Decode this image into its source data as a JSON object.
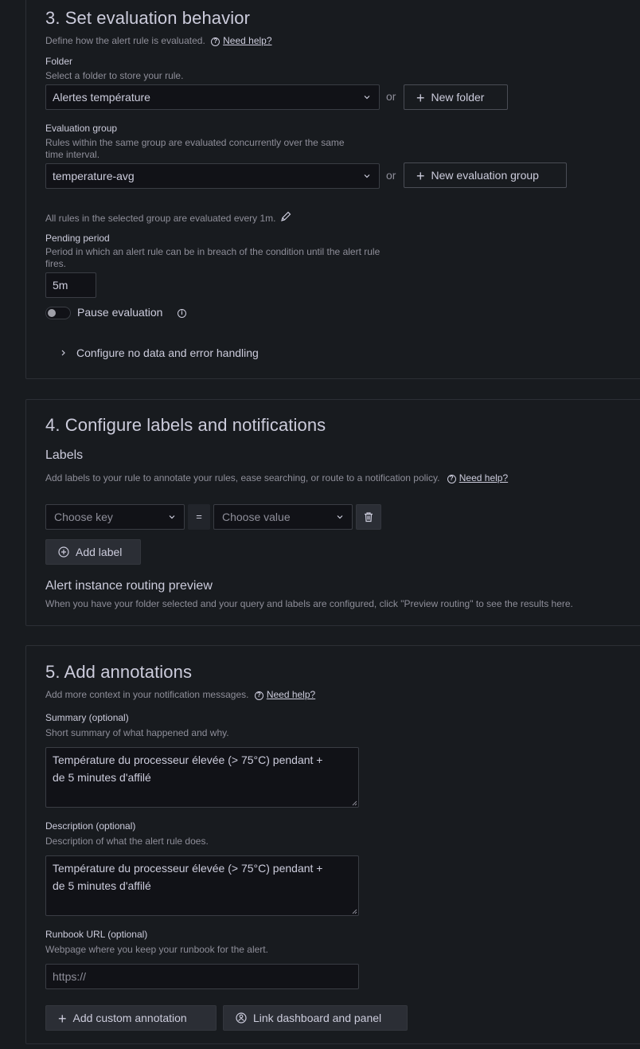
{
  "section3": {
    "title": "3. Set evaluation behavior",
    "description": "Define how the alert rule is evaluated.",
    "help_link": "Need help?",
    "folder": {
      "label": "Folder",
      "description": "Select a folder to store your rule.",
      "value": "Alertes température",
      "or": "or",
      "new_button": "New folder"
    },
    "evaluation_group": {
      "label": "Evaluation group",
      "description_line1": "Rules within the same group are evaluated concurrently over the same",
      "description_line2": "time interval.",
      "value": "temperature-avg",
      "or": "or",
      "new_button": "New evaluation group",
      "interval_note": "All rules in the selected group are evaluated every 1m."
    },
    "pending_period": {
      "label": "Pending period",
      "description_line1": "Period in which an alert rule can be in breach of the condition until the alert rule",
      "description_line2": "fires.",
      "value": "5m"
    },
    "pause_evaluation": {
      "label": "Pause evaluation",
      "enabled": false
    },
    "no_data_toggle": "Configure no data and error handling"
  },
  "section4": {
    "title": "4. Configure labels and notifications",
    "labels_heading": "Labels",
    "labels_description": "Add labels to your rule to annotate your rules, ease searching, or route to a notification policy.",
    "help_link": "Need help?",
    "key_placeholder": "Choose key",
    "equals": "=",
    "value_placeholder": "Choose value",
    "add_label": "Add label",
    "routing_preview_title": "Alert instance routing preview",
    "routing_preview_text": "When you have your folder selected and your query and labels are configured, click \"Preview routing\" to see the results here."
  },
  "section5": {
    "title": "5. Add annotations",
    "description": "Add more context in your notification messages.",
    "help_link": "Need help?",
    "summary": {
      "label": "Summary (optional)",
      "description": "Short summary of what happened and why.",
      "value_line1": "Température du processeur élevée (> 75°C) pendant +",
      "value_line2": "de 5 minutes d'affilé"
    },
    "description_field": {
      "label": "Description (optional)",
      "description": "Description of what the alert rule does.",
      "value_line1": "Température du processeur élevée (> 75°C) pendant +",
      "value_line2": "de 5 minutes d'affilé"
    },
    "runbook": {
      "label": "Runbook URL (optional)",
      "description": "Webpage where you keep your runbook for the alert.",
      "placeholder": "https://"
    },
    "add_custom_annotation": "Add custom annotation",
    "link_dashboard": "Link dashboard and panel"
  }
}
